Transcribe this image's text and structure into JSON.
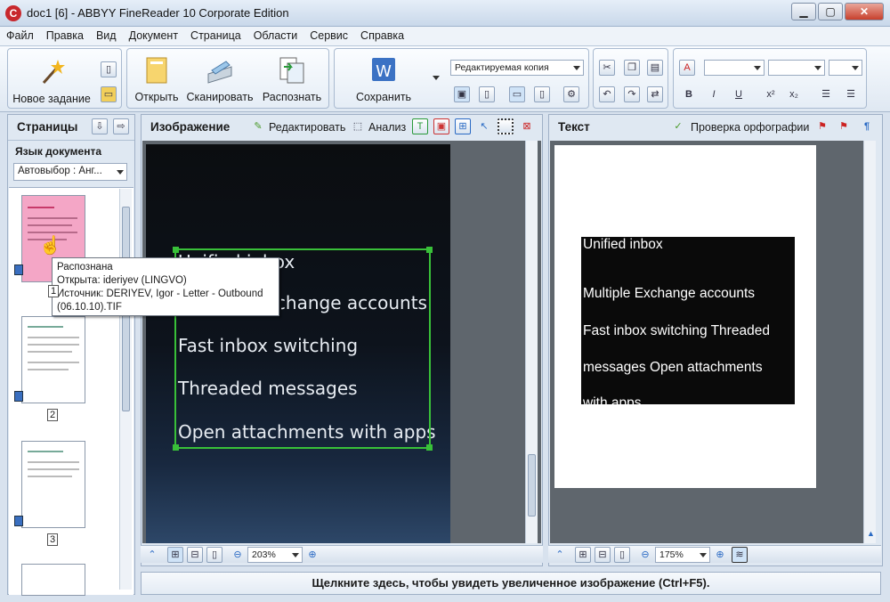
{
  "window": {
    "title": "doc1 [6] - ABBYY FineReader 10 Corporate Edition",
    "app_icon": "C",
    "buttons": {
      "minimize": "▁",
      "maximize": "▢",
      "close": "✕"
    }
  },
  "menu": [
    "Файл",
    "Правка",
    "Вид",
    "Документ",
    "Страница",
    "Области",
    "Сервис",
    "Справка"
  ],
  "toolbar": {
    "new_task": "Новое задание",
    "open": "Открыть",
    "scan": "Сканировать",
    "recognize": "Распознать",
    "save": "Сохранить",
    "save_mode": "Редактируемая копия",
    "format_buttons": [
      "B",
      "I",
      "U",
      "x²",
      "x₂"
    ]
  },
  "pages_panel": {
    "title": "Страницы",
    "language_label": "Язык документа",
    "language_value": "Автовыбор : Анг...",
    "pages": [
      {
        "number": "1"
      },
      {
        "number": "2"
      },
      {
        "number": "3"
      }
    ]
  },
  "tooltip": {
    "status": "Распознана",
    "opened": "Открыта: ideriyev (LINGVO)",
    "source_line1": "Источник: DERIYEV, Igor - Letter - Outbound",
    "source_line2": "(06.10.10).TIF"
  },
  "image_panel": {
    "title": "Изображение",
    "edit": "Редактировать",
    "analyze": "Анализ",
    "zoom": "203%",
    "image_lines": [
      "Unified inbox",
      "Multiple Exchange accounts",
      "Fast inbox switching",
      "Threaded messages",
      "Open attachments with apps"
    ]
  },
  "text_panel": {
    "title": "Текст",
    "spellcheck": "Проверка орфографии",
    "zoom": "175%",
    "lines": [
      "Unified inbox",
      "Multiple Exchange accounts",
      "Fast inbox switching Threaded",
      "messages Open attachments",
      "with apps"
    ]
  },
  "status_bar": "Щелкните здесь, чтобы увидеть увеличенное изображение (Ctrl+F5).",
  "colors": {
    "selection": "#39c039",
    "thumb_highlight": "#f4a6c6",
    "accent": "#c8282d"
  }
}
